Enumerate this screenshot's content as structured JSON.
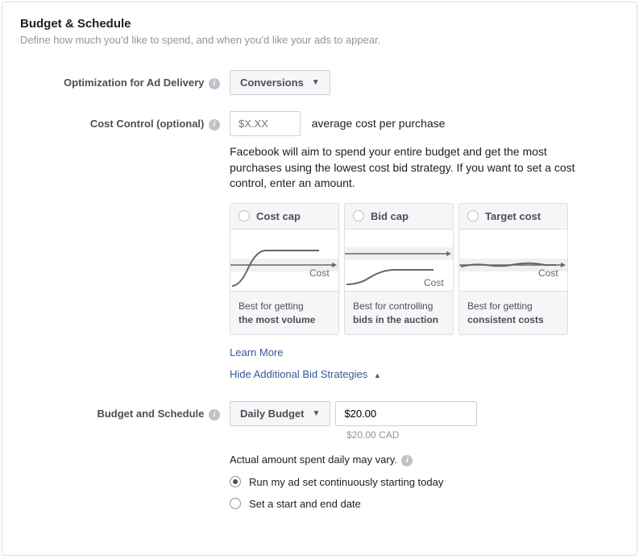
{
  "header": {
    "title": "Budget & Schedule",
    "subtitle": "Define how much you'd like to spend, and when you'd like your ads to appear."
  },
  "optimization": {
    "label": "Optimization for Ad Delivery",
    "value": "Conversions"
  },
  "cost_control": {
    "label": "Cost Control (optional)",
    "placeholder": "$X.XX",
    "inline_text": "average cost per purchase",
    "help_text": "Facebook will aim to spend your entire budget and get the most purchases using the lowest cost bid strategy. If you want to set a cost control, enter an amount."
  },
  "strategies": [
    {
      "title": "Cost cap",
      "desc1": "Best for getting",
      "desc2": "the most volume"
    },
    {
      "title": "Bid cap",
      "desc1": "Best for controlling",
      "desc2": "bids in the auction"
    },
    {
      "title": "Target cost",
      "desc1": "Best for getting",
      "desc2": "consistent costs"
    }
  ],
  "links": {
    "learn_more": "Learn More",
    "hide_strategies": "Hide Additional Bid Strategies"
  },
  "budget": {
    "label": "Budget and Schedule",
    "type": "Daily Budget",
    "amount": "$20.00",
    "converted": "$20.00 CAD",
    "vary_text": "Actual amount spent daily may vary.",
    "schedule_options": {
      "continuous": "Run my ad set continuously starting today",
      "start_end": "Set a start and end date"
    }
  },
  "graph_label": "Cost"
}
